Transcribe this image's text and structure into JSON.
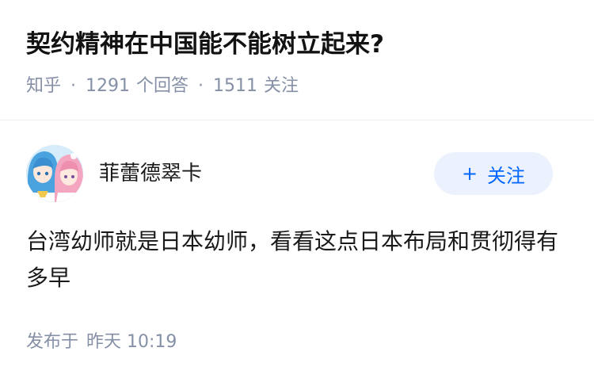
{
  "question": {
    "title": "契约精神在中国能不能树立起来?",
    "source": "知乎",
    "answer_count": "1291",
    "answer_label": "个回答",
    "follower_count": "1511",
    "follower_label": "关注"
  },
  "answer": {
    "author": {
      "name": "菲蕾德翠卡",
      "avatar_icon": "anime-characters-avatar"
    },
    "follow_button": {
      "plus": "+",
      "label": "关注"
    },
    "content": "台湾幼师就是日本幼师，看看这点日本布局和贯彻得有多早",
    "publish_label": "发布于",
    "publish_time": "昨天 10:19"
  },
  "colors": {
    "meta_text": "#8590a6",
    "accent_blue": "#0066ff",
    "follow_bg": "#ebf2fd",
    "title_text": "#121212"
  }
}
